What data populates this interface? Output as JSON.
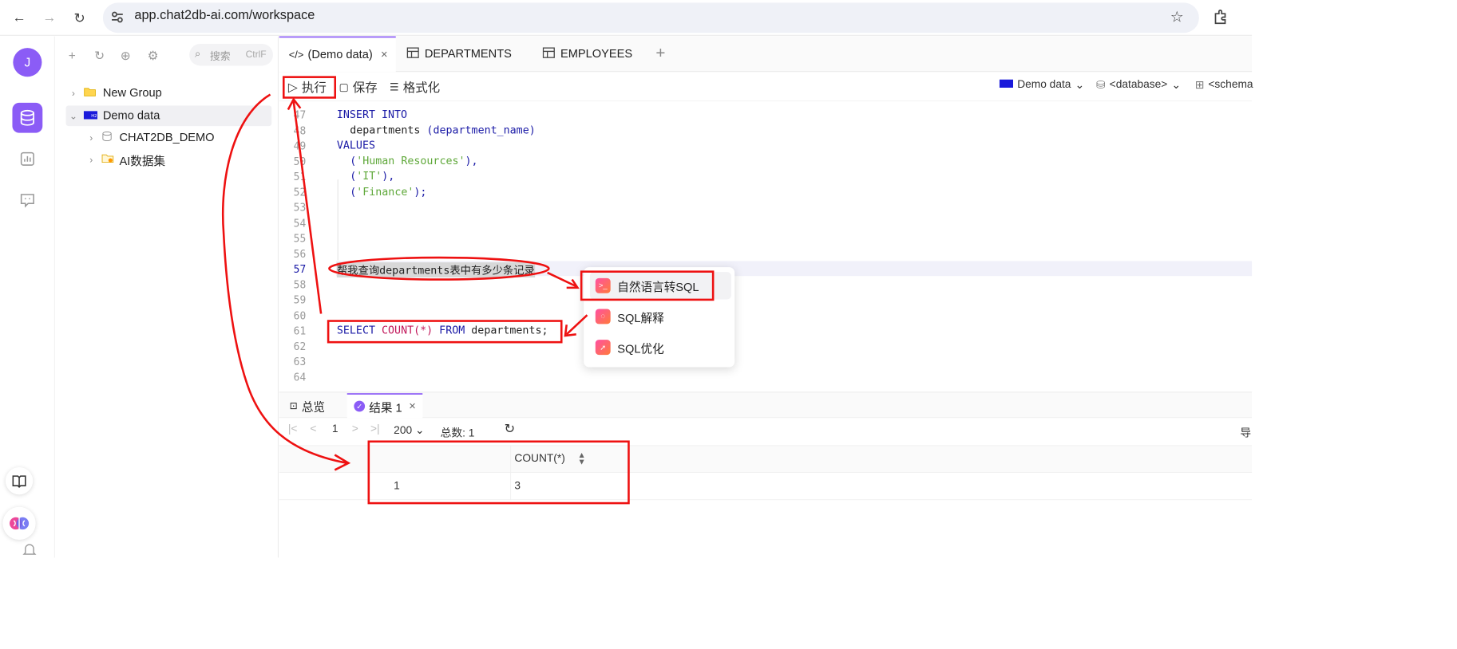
{
  "browser": {
    "url": "app.chat2db-ai.com/workspace",
    "back_icon": "←",
    "forward_icon": "→",
    "reload_icon": "↻"
  },
  "rail": {
    "avatar_letter": "J"
  },
  "tree": {
    "search_placeholder": "搜索",
    "search_shortcut": "CtrlF",
    "items": [
      {
        "label": "New Group"
      },
      {
        "label": "Demo data"
      },
      {
        "label": "CHAT2DB_DEMO"
      },
      {
        "label": "AI数据集"
      }
    ]
  },
  "tabs": [
    {
      "label": "(Demo data)"
    },
    {
      "label": "DEPARTMENTS"
    },
    {
      "label": "EMPLOYEES"
    }
  ],
  "toolbar": {
    "run": "执行",
    "save": "保存",
    "format": "格式化",
    "datasource": "Demo data",
    "database": "<database>",
    "schema": "<schema"
  },
  "editor": {
    "line_numbers": [
      "47",
      "48",
      "49",
      "50",
      "51",
      "52",
      "53",
      "54",
      "55",
      "56",
      "57",
      "58",
      "59",
      "60",
      "61",
      "62",
      "63",
      "64"
    ],
    "insert": "INSERT INTO",
    "departments_line": "departments",
    "column_paren": "(department_name)",
    "values": "VALUES",
    "v1": "'Human Resources'",
    "v2": "'IT'",
    "v3": "'Finance'",
    "nl_prompt": "帮我查询departments表中有多少条记录",
    "select_kw": "SELECT",
    "count_fn": "COUNT(*)",
    "from_kw": "FROM",
    "table": "departments;"
  },
  "ai_menu": [
    {
      "label": "自然语言转SQL"
    },
    {
      "label": "SQL解释"
    },
    {
      "label": "SQL优化"
    }
  ],
  "result": {
    "tab_overview": "总览",
    "tab_result": "结果 1",
    "page": "1",
    "page_size": "200",
    "total_label": "总数:",
    "total": "1",
    "export": "导",
    "columns": [
      "COUNT(*)"
    ],
    "rows": [
      {
        "index": "1",
        "value": "3"
      }
    ]
  },
  "colors": {
    "accent": "#8b5cf6",
    "annotation": "#e11111"
  }
}
